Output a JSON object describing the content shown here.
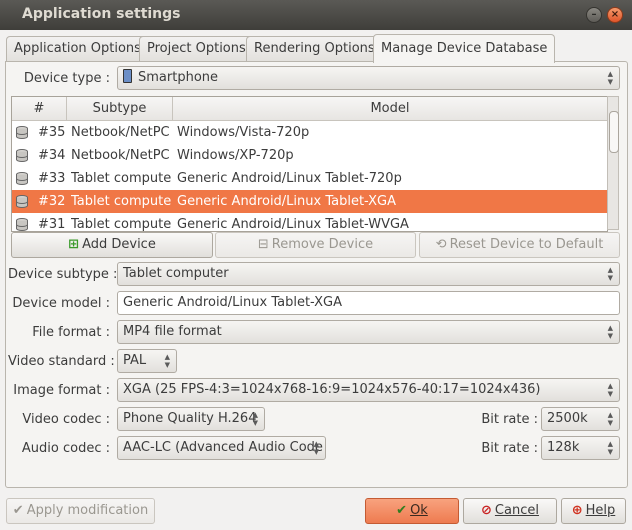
{
  "window": {
    "title": "Application settings"
  },
  "tabs": [
    "Application Options",
    "Project Options",
    "Rendering Options",
    "Manage Device Database"
  ],
  "device_type": {
    "label": "Device type :",
    "value": "Smartphone"
  },
  "table": {
    "columns": [
      "#",
      "Subtype",
      "Model"
    ],
    "rows": [
      {
        "id": "#35",
        "subtype": "Netbook/NetPC",
        "model": "Windows/Vista-720p"
      },
      {
        "id": "#34",
        "subtype": "Netbook/NetPC",
        "model": "Windows/XP-720p"
      },
      {
        "id": "#33",
        "subtype": "Tablet computer",
        "model": "Generic Android/Linux Tablet-720p"
      },
      {
        "id": "#32",
        "subtype": "Tablet computer",
        "model": "Generic Android/Linux Tablet-XGA",
        "selected": true
      },
      {
        "id": "#31",
        "subtype": "Tablet computer",
        "model": "Generic Android/Linux Tablet-WVGA"
      }
    ]
  },
  "actions": {
    "add": "Add Device",
    "remove": "Remove Device",
    "reset": "Reset Device to Default"
  },
  "form": {
    "subtype_label": "Device subtype :",
    "subtype_value": "Tablet computer",
    "model_label": "Device model :",
    "model_value": "Generic Android/Linux Tablet-XGA",
    "file_format_label": "File format :",
    "file_format_value": "MP4 file format",
    "video_standard_label": "Video standard :",
    "video_standard_value": "PAL",
    "image_format_label": "Image format :",
    "image_format_value": "XGA (25 FPS-4:3=1024x768-16:9=1024x576-40:17=1024x436)",
    "video_codec_label": "Video codec :",
    "video_codec_value": "Phone Quality H.264",
    "video_bitrate_label": "Bit rate :",
    "video_bitrate_value": "2500k",
    "audio_codec_label": "Audio codec :",
    "audio_codec_value": "AAC-LC (Advanced Audio Code",
    "audio_bitrate_label": "Bit rate :",
    "audio_bitrate_value": "128k"
  },
  "footer": {
    "apply": "Apply modification",
    "ok": "Ok",
    "cancel": "Cancel",
    "help": "Help"
  },
  "colors": {
    "selection": "#f07746",
    "titlebar": "#3f3e3a"
  }
}
